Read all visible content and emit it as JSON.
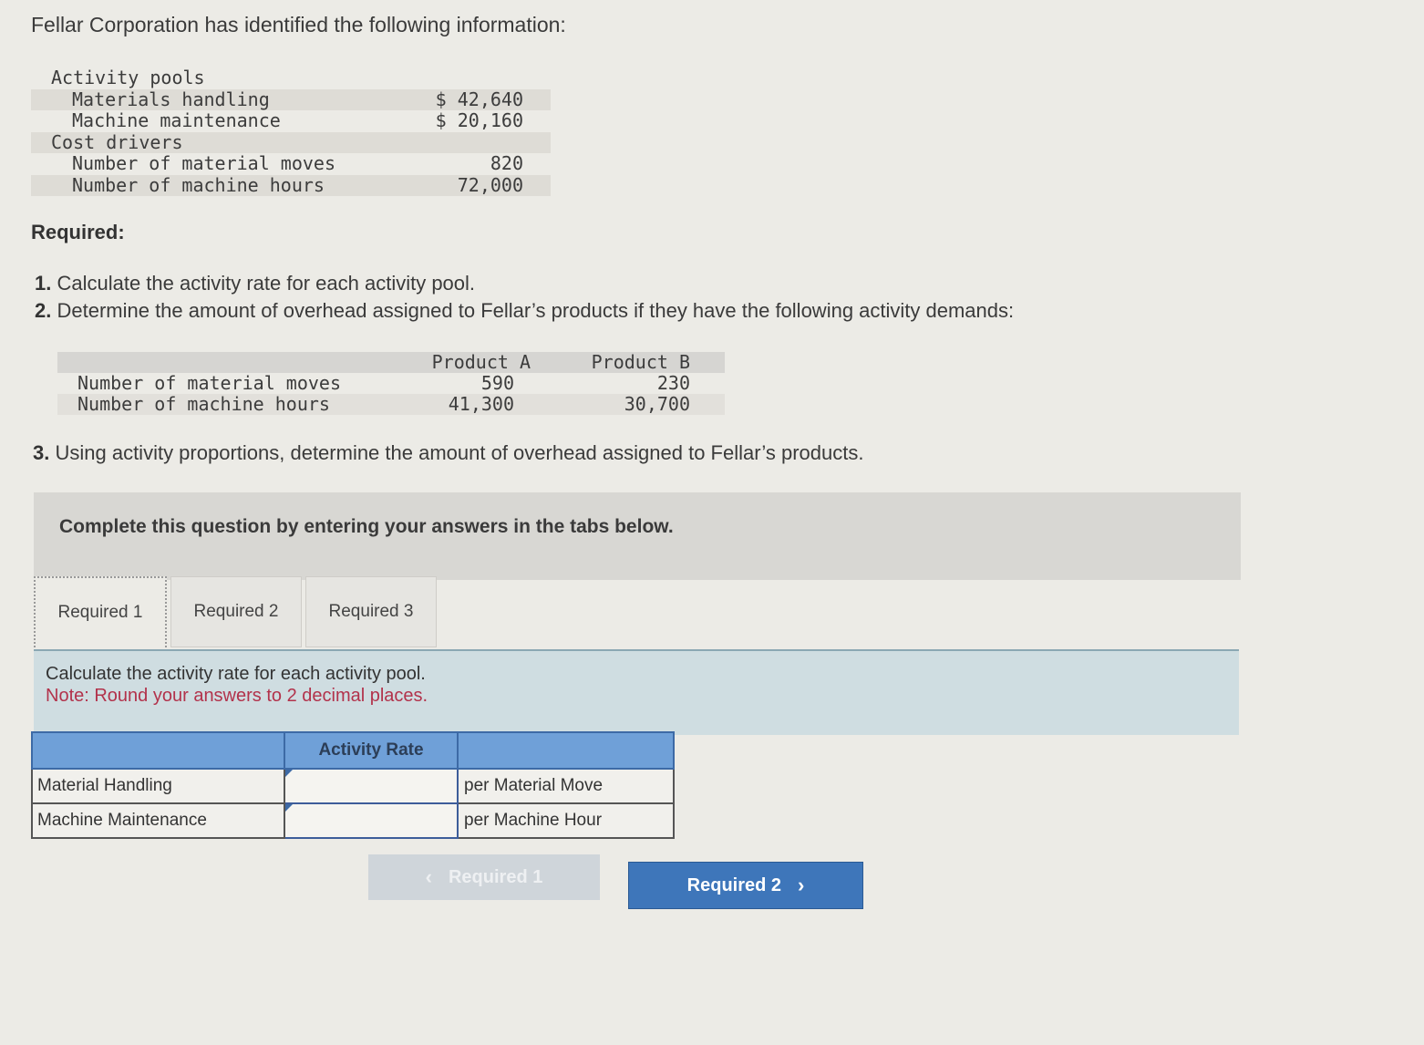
{
  "intro": "Fellar Corporation has identified the following information:",
  "info": {
    "activity_pools_label": "Activity pools",
    "pools": [
      {
        "label": "Materials handling",
        "value": "$ 42,640"
      },
      {
        "label": "Machine maintenance",
        "value": "$ 20,160"
      }
    ],
    "cost_drivers_label": "Cost drivers",
    "drivers": [
      {
        "label": "Number of material moves",
        "value": "820"
      },
      {
        "label": "Number of machine hours",
        "value": "72,000"
      }
    ]
  },
  "required": {
    "title": "Required:",
    "items": [
      {
        "num": "1.",
        "text": " Calculate the activity rate for each activity pool."
      },
      {
        "num": "2.",
        "text": " Determine the amount of overhead assigned to Fellar’s products if they have the following activity demands:"
      }
    ],
    "item3": {
      "num": "3.",
      "text": " Using activity proportions, determine the amount of overhead assigned to Fellar’s products."
    }
  },
  "demands": {
    "headers": [
      "Product A",
      "Product B"
    ],
    "rows": [
      {
        "label": "Number of material moves",
        "a": "590",
        "b": "230"
      },
      {
        "label": "Number of machine hours",
        "a": "41,300",
        "b": "30,700"
      }
    ]
  },
  "banner": "Complete this question by entering your answers in the tabs below.",
  "tabs": [
    {
      "label": "Required 1",
      "active": true
    },
    {
      "label": "Required 2",
      "active": false
    },
    {
      "label": "Required 3",
      "active": false
    }
  ],
  "instructions": {
    "line1": "Calculate the activity rate for each activity pool.",
    "note": "Note: Round your answers to 2 decimal places."
  },
  "rate_table": {
    "header": "Activity Rate",
    "rows": [
      {
        "label": "Material Handling",
        "value": "",
        "unit": "per Material Move"
      },
      {
        "label": "Machine Maintenance",
        "value": "",
        "unit": "per Machine Hour"
      }
    ]
  },
  "nav": {
    "prev_label": "Required 1",
    "next_label": "Required 2",
    "prev_icon": "‹",
    "next_icon": "›"
  }
}
